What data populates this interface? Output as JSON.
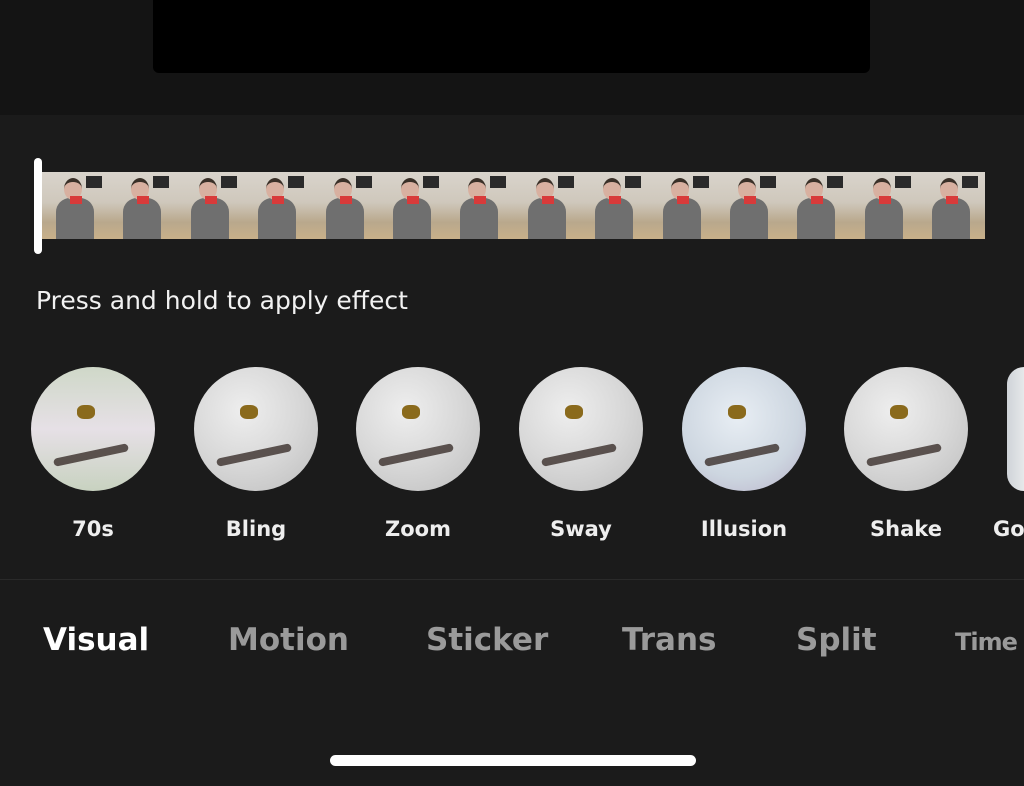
{
  "timeline": {
    "hint": "Press and hold to apply effect",
    "frame_count": 14
  },
  "effects": [
    {
      "label": "70s"
    },
    {
      "label": "Bling"
    },
    {
      "label": "Zoom"
    },
    {
      "label": "Sway"
    },
    {
      "label": "Illusion"
    },
    {
      "label": "Shake"
    },
    {
      "label": "Go"
    }
  ],
  "tabs": [
    {
      "label": "Visual",
      "active": true
    },
    {
      "label": "Motion"
    },
    {
      "label": "Sticker"
    },
    {
      "label": "Trans"
    },
    {
      "label": "Split"
    },
    {
      "label": "Time"
    }
  ]
}
